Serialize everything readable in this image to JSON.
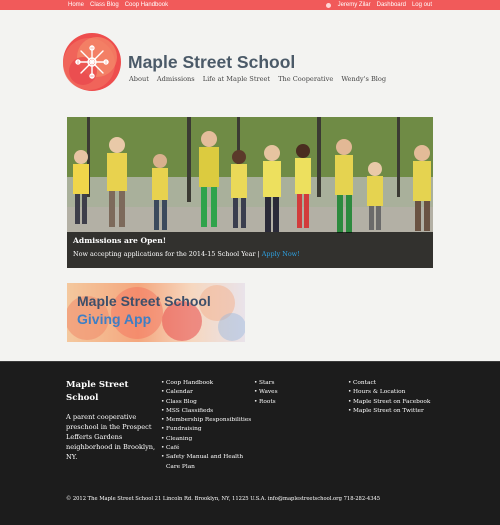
{
  "admin_bar": {
    "left_links": [
      "Home",
      "Class Blog",
      "Coop Handbook"
    ],
    "user_name": "Jeremy Zilar",
    "dashboard": "Dashboard",
    "logout": "Log out"
  },
  "site": {
    "title": "Maple Street School",
    "nav": [
      "About",
      "Admissions",
      "Life at Maple Street",
      "The Cooperative",
      "Wendy's Blog"
    ]
  },
  "hero": {
    "title": "Admissions are Open!",
    "text": "Now accepting applications for the 2014-15 School Year |",
    "link": "Apply Now!"
  },
  "giving_banner": {
    "line1": "Maple Street School",
    "line2": "Giving App"
  },
  "footer": {
    "title": "Maple Street School",
    "description": "A parent cooperative preschool in the Prospect Lefferts Gardens neighborhood in Brooklyn, NY.",
    "col1": [
      "Coop Handbook",
      "Calendar",
      "Class Blog",
      "MSS Classifieds",
      "Membership Responsibilities",
      "Fundraising",
      "Cleaning",
      "Café",
      "Safety Manual and Health Care Plan"
    ],
    "col2": [
      "Stars",
      "Waves",
      "Roots"
    ],
    "col3": [
      "Contact",
      "Hours & Location",
      "Maple Street on Facebook",
      "Maple Street on Twitter"
    ],
    "copyright": "© 2012 The Maple Street School  21 Lincoln Rd. Brooklyn, NY, 11225 U.S.A.    info@maplestreetschool.org  718-282-4345"
  },
  "colors": {
    "admin_bar": "#f15a5a",
    "title": "#4b5a68",
    "link": "#2ea2e3",
    "footer_bg": "#1c1c1c"
  }
}
